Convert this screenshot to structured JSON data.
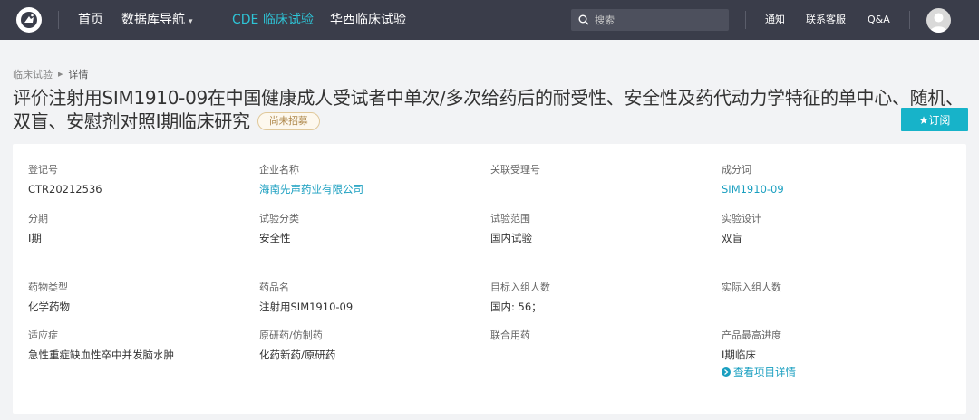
{
  "nav": {
    "home": "首页",
    "db_nav": "数据库导航",
    "cde": "CDE 临床试验",
    "huaxi": "华西临床试验",
    "search_placeholder": "搜索",
    "notice": "通知",
    "support": "联系客服",
    "qa": "Q&A"
  },
  "breadcrumb": {
    "parent": "临床试验",
    "current": "详情"
  },
  "title": {
    "text": "评价注射用SIM1910-09在中国健康成人受试者中单次/多次给药后的耐受性、安全性及药代动力学特征的单中心、随机、双盲、安慰剂对照I期临床研究",
    "status": "尚未招募"
  },
  "subscribe_label": "★订阅",
  "fields": {
    "reg_no": {
      "label": "登记号",
      "value": "CTR20212536"
    },
    "company": {
      "label": "企业名称",
      "value": "海南先声药业有限公司"
    },
    "accept_no": {
      "label": "关联受理号",
      "value": ""
    },
    "ingredient": {
      "label": "成分词",
      "value": "SIM1910-09"
    },
    "phase": {
      "label": "分期",
      "value": "I期"
    },
    "category": {
      "label": "试验分类",
      "value": "安全性"
    },
    "scope": {
      "label": "试验范围",
      "value": "国内试验"
    },
    "design": {
      "label": "实验设计",
      "value": "双盲"
    },
    "drug_type": {
      "label": "药物类型",
      "value": "化学药物"
    },
    "drug_name": {
      "label": "药品名",
      "value": "注射用SIM1910-09"
    },
    "target_enroll": {
      "label": "目标入组人数",
      "value": "国内: 56；"
    },
    "actual_enroll": {
      "label": "实际入组人数",
      "value": ""
    },
    "indication": {
      "label": "适应症",
      "value": "急性重症缺血性卒中并发脑水肿"
    },
    "origin": {
      "label": "原研药/仿制药",
      "value": "化药新药/原研药"
    },
    "combo": {
      "label": "联合用药",
      "value": ""
    },
    "progress": {
      "label": "产品最高进度",
      "value": "I期临床",
      "link": "查看项目详情"
    }
  },
  "colors": {
    "topbar": "#3a3d4a",
    "accent": "#2ec4d6",
    "link": "#1a9fc0",
    "subscribe": "#17b3c9"
  }
}
